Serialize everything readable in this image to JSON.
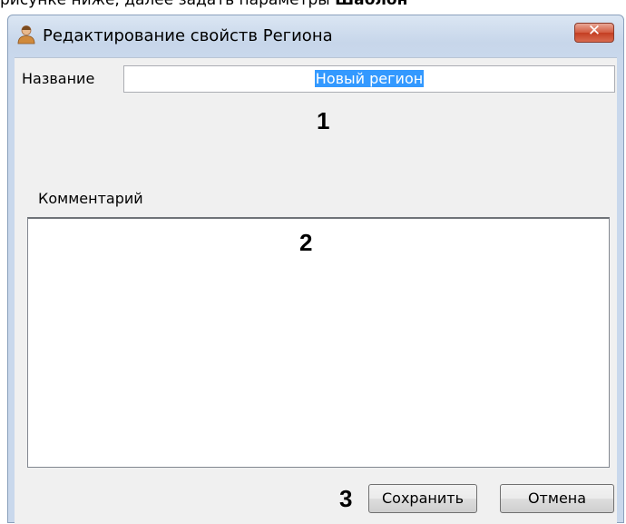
{
  "background_text": {
    "before": "рисунке ниже, далее задать параметры",
    "bold": "Шаблон"
  },
  "window": {
    "title": "Редактирование свойств Региона",
    "close_label": "✕",
    "icon": "user-icon"
  },
  "form": {
    "name_label": "Название",
    "name_value": "Новый регион",
    "comment_label": "Комментарий",
    "comment_value": ""
  },
  "markers": {
    "m1": "1",
    "m2": "2",
    "m3": "3"
  },
  "buttons": {
    "save": "Сохранить",
    "cancel": "Отмена"
  },
  "colors": {
    "selection": "#3399ff",
    "close_button": "#c43e22"
  }
}
